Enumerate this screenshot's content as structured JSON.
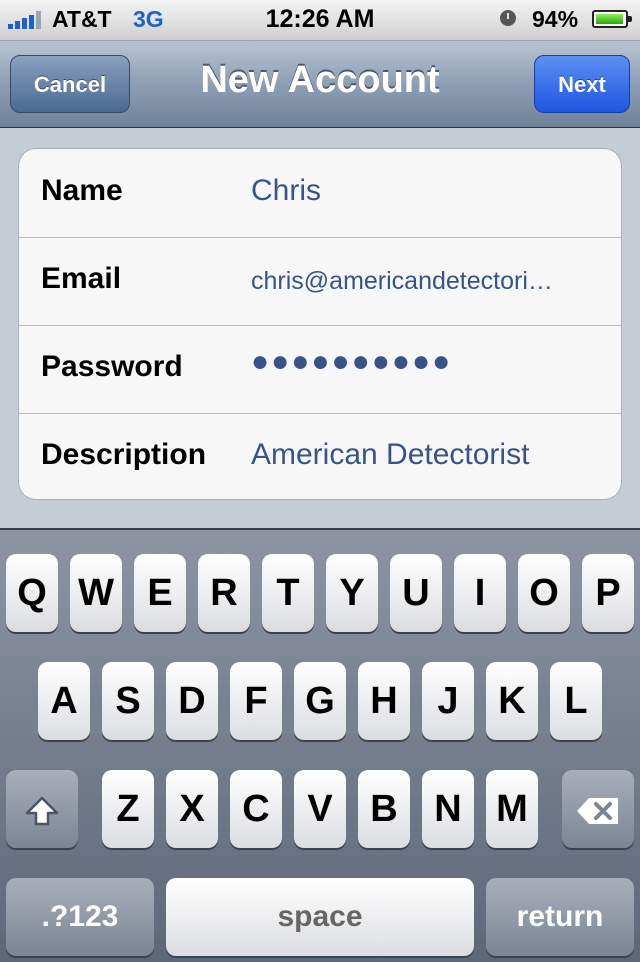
{
  "status_bar": {
    "carrier": "AT&T",
    "network": "3G",
    "time": "12:26 AM",
    "battery": "94%",
    "battery_level": 0.94
  },
  "nav": {
    "title": "New Account",
    "cancel_label": "Cancel",
    "next_label": "Next"
  },
  "form": {
    "rows": [
      {
        "label": "Name",
        "value": "Chris"
      },
      {
        "label": "Email",
        "value": "chris@americandetectori…"
      },
      {
        "label": "Password",
        "value": "●●●●●●●●●●"
      },
      {
        "label": "Description",
        "value": "American Detectorist"
      }
    ]
  },
  "keyboard": {
    "row1": [
      "Q",
      "W",
      "E",
      "R",
      "T",
      "Y",
      "U",
      "I",
      "O",
      "P"
    ],
    "row2": [
      "A",
      "S",
      "D",
      "F",
      "G",
      "H",
      "J",
      "K",
      "L"
    ],
    "row3": [
      "Z",
      "X",
      "C",
      "V",
      "B",
      "N",
      "M"
    ],
    "numbers_label": ".?123",
    "space_label": "space",
    "return_label": "return",
    "shift_icon": "shift-icon",
    "delete_icon": "backspace-icon"
  }
}
